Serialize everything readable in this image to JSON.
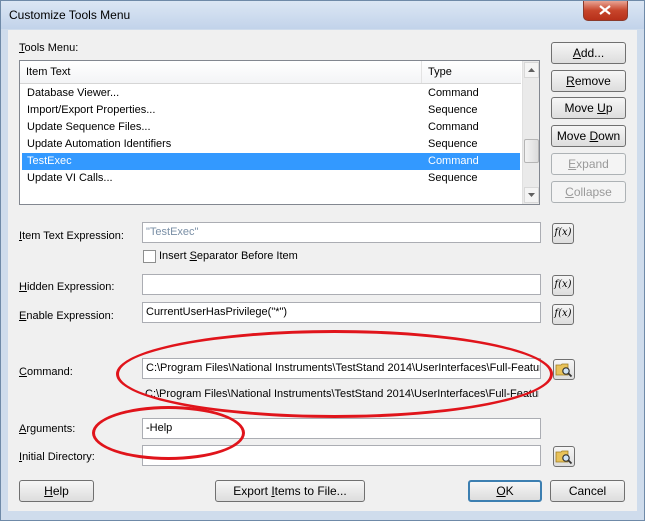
{
  "window": {
    "title": "Customize Tools Menu",
    "close_icon": "close-x-icon"
  },
  "tools_menu": {
    "label_u": "T",
    "label_rest": "ools Menu:",
    "columns": [
      "Item Text",
      "Type"
    ],
    "rows": [
      {
        "text": "Database Viewer...",
        "type": "Command"
      },
      {
        "text": "Import/Export Properties...",
        "type": "Sequence"
      },
      {
        "text": "Update Sequence Files...",
        "type": "Command"
      },
      {
        "text": "Update Automation Identifiers",
        "type": "Sequence"
      },
      {
        "text": "TestExec",
        "type": "Command",
        "selected": true
      },
      {
        "text": "Update VI Calls...",
        "type": "Sequence"
      }
    ]
  },
  "side_buttons": {
    "add_u": "A",
    "add_rest": "dd...",
    "remove_u": "R",
    "remove_rest": "emove",
    "moveup_pre": "Move ",
    "moveup_u": "U",
    "moveup_rest": "p",
    "movedown_pre": "Move ",
    "movedown_u": "D",
    "movedown_rest": "own",
    "expand_u": "E",
    "expand_rest": "xpand",
    "collapse_u": "C",
    "collapse_rest": "ollapse"
  },
  "item_text": {
    "label_u": "I",
    "label_rest": "tem Text Expression:",
    "value": "\"TestExec\""
  },
  "separator": {
    "label_pre": "Insert ",
    "label_u": "S",
    "label_rest": "eparator Before Item",
    "checked": false
  },
  "hidden": {
    "label_u": "H",
    "label_rest": "idden Expression:",
    "value": ""
  },
  "enable": {
    "label_u": "E",
    "label_rest": "nable Expression:",
    "value": "CurrentUserHasPrivilege(\"*\")"
  },
  "command": {
    "label_u": "C",
    "label_rest": "ommand:",
    "value": "C:\\Program Files\\National Instruments\\TestStand 2014\\UserInterfaces\\Full-Featured",
    "resolved": "C:\\Program Files\\National Instruments\\TestStand 2014\\UserInterfaces\\Full-Featured"
  },
  "arguments": {
    "label_u": "A",
    "label_rest": "rguments:",
    "value": "-Help"
  },
  "initial_dir": {
    "label_u": "I",
    "label_rest": "nitial Directory:",
    "value": ""
  },
  "fx_label": "f(x)",
  "bottom_buttons": {
    "help_u": "H",
    "help_rest": "elp",
    "export_pre": "Export ",
    "export_u": "I",
    "export_rest": "tems to File...",
    "ok_u": "O",
    "ok_rest": "K",
    "cancel": "Cancel"
  },
  "colors": {
    "annotation": "#e0141b",
    "selection": "#3399ff"
  }
}
